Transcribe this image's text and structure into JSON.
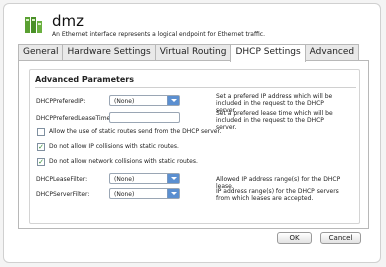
{
  "header": {
    "title": "dmz",
    "subtitle": "An Ethernet interface represents a logical endpoint for Ethernet traffic."
  },
  "tabs": [
    {
      "label": "General"
    },
    {
      "label": "Hardware Settings"
    },
    {
      "label": "Virtual Routing"
    },
    {
      "label": "DHCP Settings"
    },
    {
      "label": "Advanced"
    }
  ],
  "active_tab": "DHCP Settings",
  "section": {
    "title": "Advanced Parameters"
  },
  "fields": {
    "prefered_ip": {
      "label": "DHCPPreferedIP:",
      "value": "(None)",
      "description": "Set a prefered IP address which will be included in the request to the DHCP server."
    },
    "prefered_lease": {
      "label": "DHCPPreferedLeaseTime:",
      "value": "",
      "description": "Set a prefered lease time which will be included in the request to the DHCP server."
    },
    "lease_filter": {
      "label": "DHCPLeaseFilter:",
      "value": "(None)",
      "description": "Allowed IP address range(s) for the DHCP lease."
    },
    "server_filter": {
      "label": "DHCPServerFilter:",
      "value": "(None)",
      "description": "IP address range(s) for the DHCP servers from which leases are accepted."
    }
  },
  "checkboxes": {
    "static_routes": {
      "label": "Allow the use of static routes send from the DHCP server.",
      "checked": false
    },
    "ip_collisions": {
      "label": "Do not allow IP collisions with static routes.",
      "checked": true
    },
    "net_collisions": {
      "label": "Do not allow network collisions with static routes.",
      "checked": true
    }
  },
  "buttons": {
    "ok": "OK",
    "cancel": "Cancel"
  },
  "colors": {
    "accent": "#5b8fd0",
    "check": "#2a8a2a"
  }
}
